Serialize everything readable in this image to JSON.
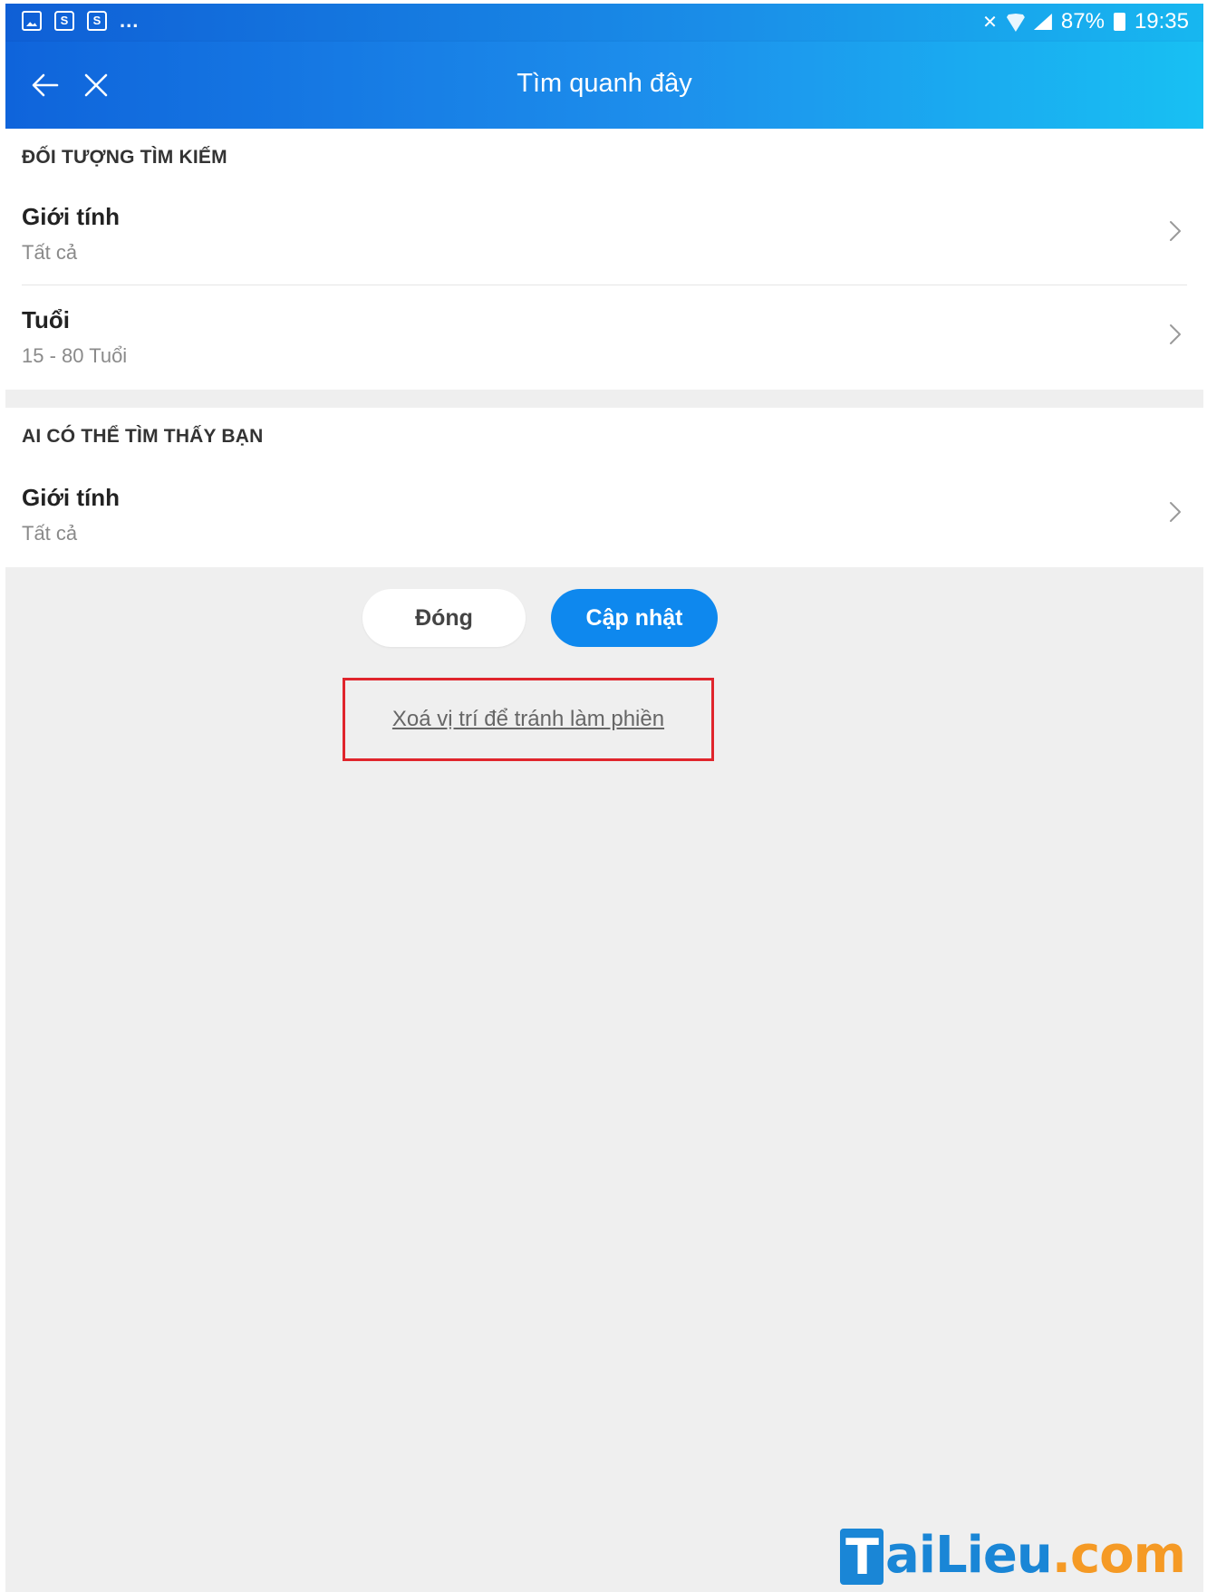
{
  "status_bar": {
    "notifications": [
      "gallery-icon",
      "shopee-icon",
      "shopee-icon"
    ],
    "more": "...",
    "battery": "87%",
    "time": "19:35"
  },
  "header": {
    "title": "Tìm quanh đây",
    "back_icon": "arrow-left-icon",
    "close_icon": "close-icon"
  },
  "search_target": {
    "heading": "ĐỐI TƯỢNG TÌM KIẾM",
    "rows": [
      {
        "label": "Giới tính",
        "value": "Tất cả"
      },
      {
        "label": "Tuổi",
        "value": "15 - 80 Tuổi"
      }
    ]
  },
  "visibility": {
    "heading": "AI CÓ THỂ TÌM THẤY BẠN",
    "rows": [
      {
        "label": "Giới tính",
        "value": "Tất cả"
      }
    ]
  },
  "actions": {
    "close_label": "Đóng",
    "update_label": "Cập nhật",
    "clear_location_label": "Xoá vị trí để tránh làm phiền"
  },
  "colors": {
    "header_start": "#0f64db",
    "header_end": "#18c0f3",
    "primary_button": "#0e88ee",
    "highlight_border": "#e0252c",
    "background": "#efefef"
  },
  "watermark": {
    "first": "T",
    "middle": "aiLieu",
    "suffix": ".com"
  }
}
